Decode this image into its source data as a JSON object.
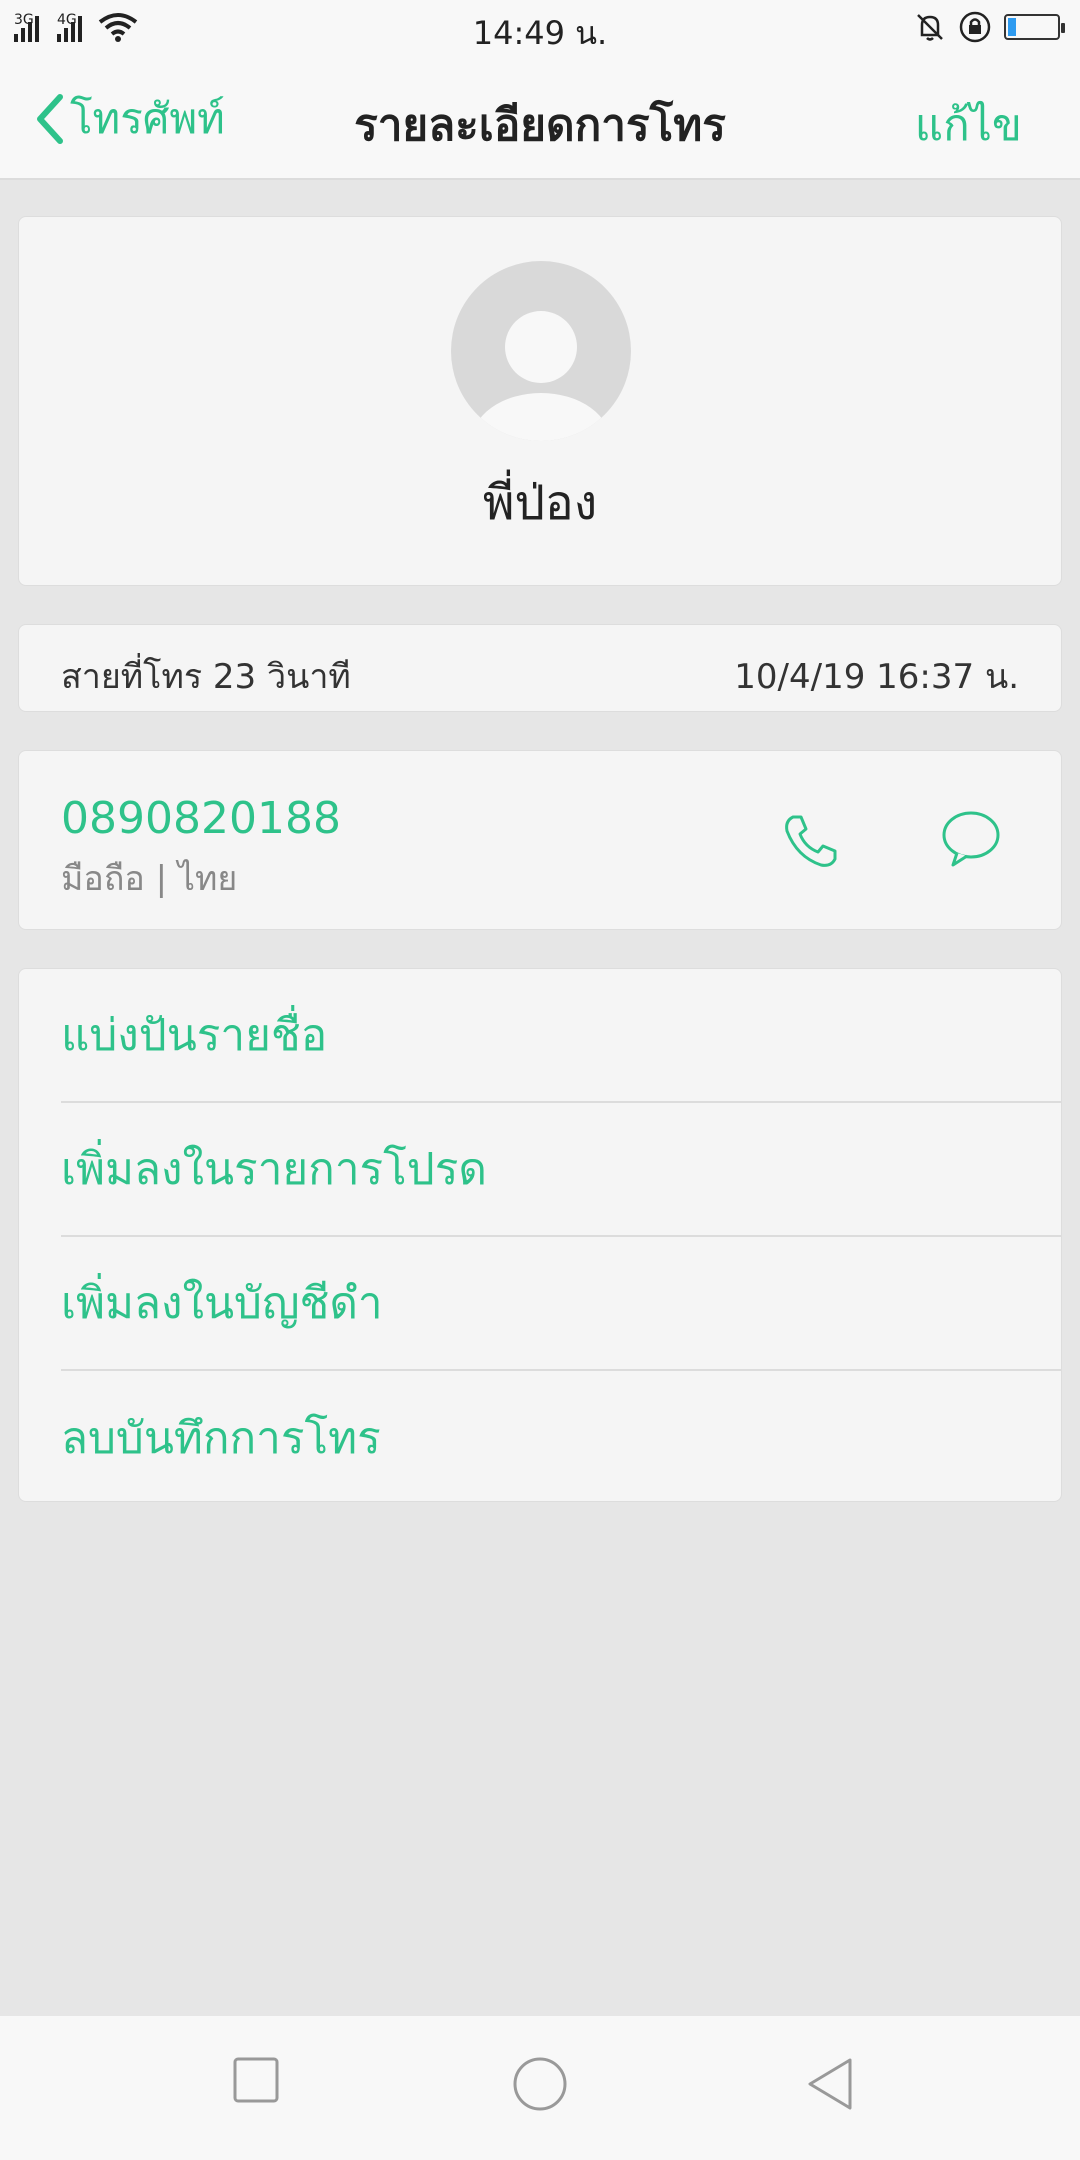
{
  "status_bar": {
    "time": "14:49 น.",
    "sim1_label": "3G",
    "sim2_label": "4G",
    "battery_level_percent": 15,
    "icons": [
      "signal-icon",
      "wifi-icon",
      "silent-bell-icon",
      "rotation-lock-icon",
      "battery-icon"
    ]
  },
  "navbar": {
    "back_label": "โทรศัพท์",
    "title": "รายละเอียดการโทร",
    "edit_label": "แก้ไข"
  },
  "contact": {
    "name": "พี่ป่อง"
  },
  "call_info": {
    "label": "สายที่โทร  23 วินาที",
    "datetime": "10/4/19 16:37 น."
  },
  "number": {
    "value": "0890820188",
    "subtitle": "มือถือ | ไทย"
  },
  "actions": [
    {
      "label": "แบ่งปันรายชื่อ"
    },
    {
      "label": "เพิ่มลงในรายการโปรด"
    },
    {
      "label": "เพิ่มลงในบัญชีดำ"
    },
    {
      "label": "ลบบันทึกการโทร"
    }
  ],
  "colors": {
    "accent": "#2ec28a",
    "background": "#e6e6e6",
    "card": "#f5f5f5"
  }
}
